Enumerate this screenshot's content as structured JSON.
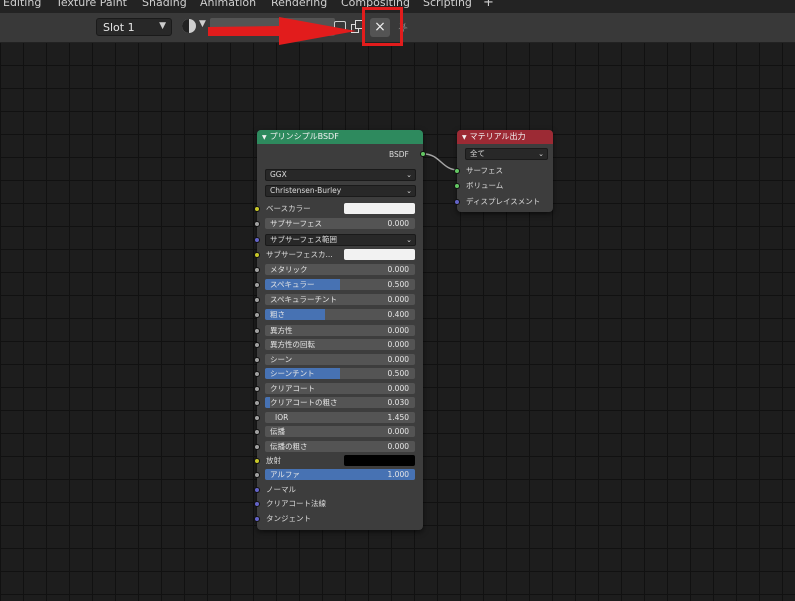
{
  "workspace_tabs": [
    "Editing",
    "Texture Paint",
    "Shading",
    "Animation",
    "Rendering",
    "Compositing",
    "Scripting"
  ],
  "workspace_add_label": "+",
  "header": {
    "slot_label": "Slot 1",
    "unlink_label": "×"
  },
  "colors": {
    "bsdf_header": "#2e8a5e",
    "output_header": "#9c2a34",
    "slider_fill": "#4772b3",
    "annotation_red": "#e21c1c",
    "socket_gray": "#a1a1a1",
    "socket_yellow": "#c7c729",
    "socket_purple": "#6363c7",
    "socket_green": "#63c763"
  },
  "bsdf_node": {
    "title": "プリンシプルBSDF",
    "output_label": "BSDF",
    "distribution": "GGX",
    "subsurface_method": "Christensen-Burley",
    "base_color_label": "ベースカラー",
    "subsurface_label": "サブサーフェス",
    "subsurface_value": "0.000",
    "subsurface_radius_label": "サブサーフェス範囲",
    "subsurface_color_label": "サブサーフェスカ...",
    "params": [
      {
        "label": "メタリック",
        "value": "0.000",
        "fill": 0.0
      },
      {
        "label": "スペキュラー",
        "value": "0.500",
        "fill": 0.5
      },
      {
        "label": "スペキュラーチント",
        "value": "0.000",
        "fill": 0.0
      },
      {
        "label": "粗さ",
        "value": "0.400",
        "fill": 0.4
      },
      {
        "label": "異方性",
        "value": "0.000",
        "fill": 0.0
      },
      {
        "label": "異方性の回転",
        "value": "0.000",
        "fill": 0.0
      },
      {
        "label": "シーン",
        "value": "0.000",
        "fill": 0.0
      },
      {
        "label": "シーンチント",
        "value": "0.500",
        "fill": 0.5
      },
      {
        "label": "クリアコート",
        "value": "0.000",
        "fill": 0.0
      },
      {
        "label": "クリアコートの粗さ",
        "value": "0.030",
        "fill": 0.03
      },
      {
        "label": "IOR",
        "value": "1.450",
        "fill": 0.0
      },
      {
        "label": "伝播",
        "value": "0.000",
        "fill": 0.0
      },
      {
        "label": "伝播の粗さ",
        "value": "0.000",
        "fill": 0.0
      }
    ],
    "emission_label": "放射",
    "alpha_label": "アルファ",
    "alpha_value": "1.000",
    "normal_label": "ノーマル",
    "clearcoat_normal_label": "クリアコート法線",
    "tangent_label": "タンジェント"
  },
  "output_node": {
    "title": "マテリアル出力",
    "target": "全て",
    "inputs": [
      "サーフェス",
      "ボリューム",
      "ディスプレイスメント"
    ]
  }
}
